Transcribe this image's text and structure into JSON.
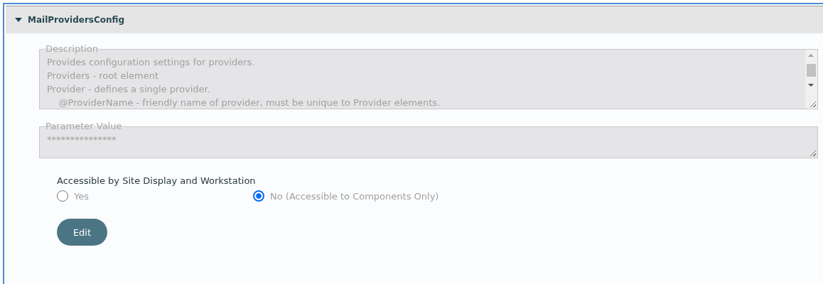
{
  "panel": {
    "title": "MailProvidersConfig",
    "expanded": true
  },
  "fields": [
    {
      "kind": "textarea",
      "label": "Description",
      "disabled": true,
      "lines": [
        "Provides configuration settings for providers.",
        "Providers - root element",
        "Provider - defines a single provider.",
        "    @ProviderName - friendly name of provider, must be unique to Provider elements."
      ]
    },
    {
      "kind": "input",
      "label": "Parameter Value",
      "disabled": true,
      "lines": [
        "***************"
      ]
    }
  ],
  "access": {
    "label": "Accessible by Site Display and Workstation",
    "options": [
      {
        "label": "Yes",
        "selected": false
      },
      {
        "label": "No (Accessible to Components Only)",
        "selected": true
      }
    ]
  },
  "buttons": [
    "Edit"
  ]
}
